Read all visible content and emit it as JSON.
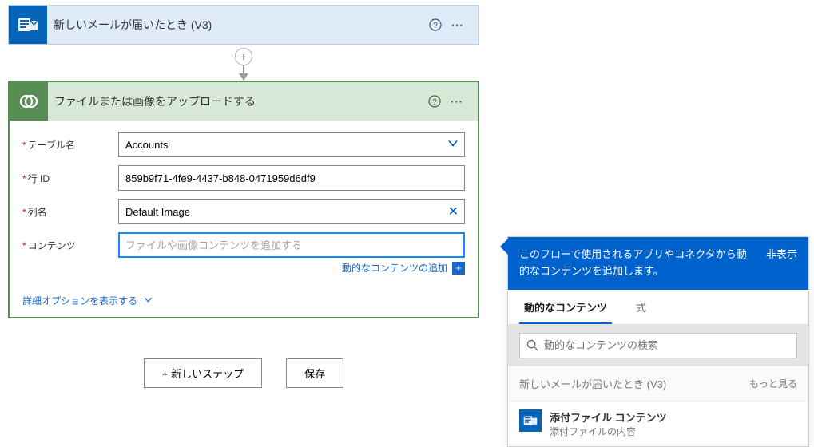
{
  "trigger": {
    "title": "新しいメールが届いたとき (V3)"
  },
  "action": {
    "title": "ファイルまたは画像をアップロードする",
    "fields": {
      "table": {
        "label": "テーブル名",
        "value": "Accounts"
      },
      "rowid": {
        "label": "行 ID",
        "value": "859b9f71-4fe9-4437-b848-0471959d6df9"
      },
      "column": {
        "label": "列名",
        "value": "Default Image"
      },
      "content": {
        "label": "コンテンツ",
        "placeholder": "ファイルや画像コンテンツを追加する"
      }
    },
    "dynamic_link": "動的なコンテンツの追加",
    "advanced": "詳細オプションを表示する"
  },
  "buttons": {
    "new_step": "+ 新しいステップ",
    "save": "保存"
  },
  "dyn_panel": {
    "header": "このフローで使用されるアプリやコネクタから動的なコンテンツを追加します。",
    "hide": "非表示",
    "tabs": {
      "dynamic": "動的なコンテンツ",
      "expr": "式"
    },
    "search_placeholder": "動的なコンテンツの検索",
    "section": {
      "title": "新しいメールが届いたとき (V3)",
      "more": "もっと見る"
    },
    "item": {
      "title": "添付ファイル コンテンツ",
      "desc": "添付ファイルの内容"
    }
  }
}
